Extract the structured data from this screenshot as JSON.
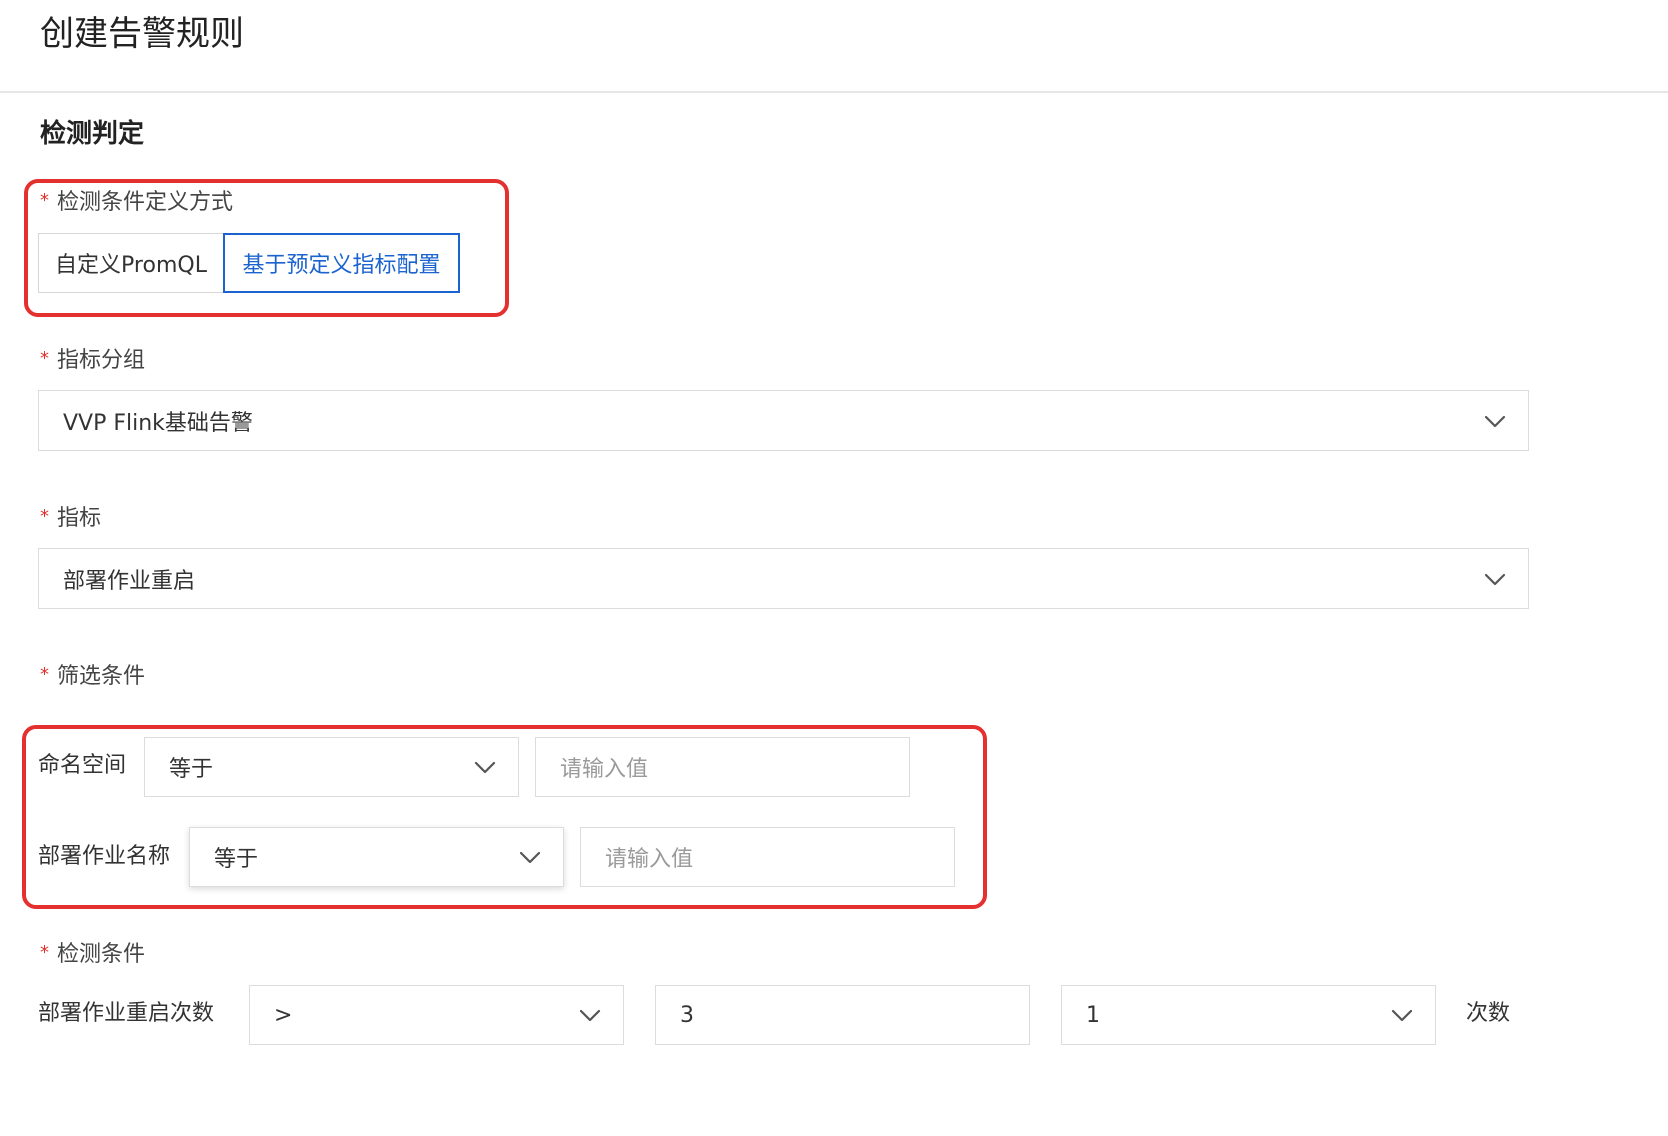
{
  "page": {
    "title": "创建告警规则",
    "section_title": "检测判定"
  },
  "definition_mode": {
    "label": "检测条件定义方式",
    "options": [
      {
        "label": "自定义PromQL",
        "selected": false
      },
      {
        "label": "基于预定义指标配置",
        "selected": true
      }
    ]
  },
  "metric_group": {
    "label": "指标分组",
    "value": "VVP Flink基础告警"
  },
  "metric": {
    "label": "指标",
    "value": "部署作业重启"
  },
  "filter": {
    "label": "筛选条件",
    "rows": [
      {
        "name": "命名空间",
        "operator": "等于",
        "placeholder": "请输入值"
      },
      {
        "name": "部署作业名称",
        "operator": "等于",
        "placeholder": "请输入值"
      }
    ]
  },
  "detection": {
    "label": "检测条件",
    "metric_name": "部署作业重启次数",
    "comparator": ">",
    "threshold": "3",
    "count": "1",
    "unit": "次数"
  },
  "colors": {
    "required": "#e0322b",
    "accent": "#1b63cf",
    "highlight": "#e53030"
  }
}
